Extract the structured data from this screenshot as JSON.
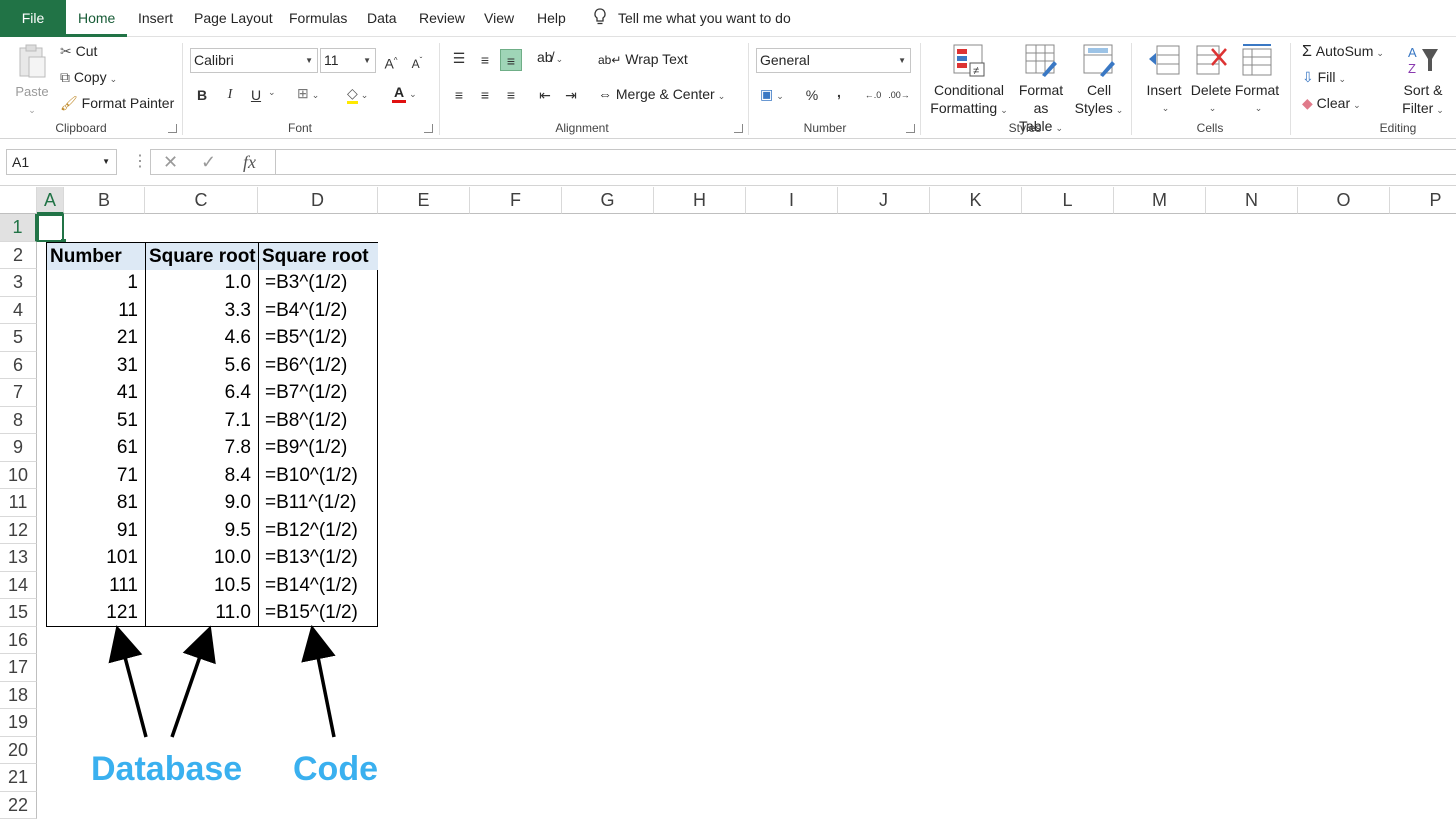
{
  "tabs": [
    "File",
    "Home",
    "Insert",
    "Page Layout",
    "Formulas",
    "Data",
    "Review",
    "View",
    "Help"
  ],
  "tell_me": "Tell me what you want to do",
  "clipboard": {
    "paste": "Paste",
    "cut": "Cut",
    "copy": "Copy",
    "format_painter": "Format Painter",
    "label": "Clipboard"
  },
  "font": {
    "name": "Calibri",
    "size": "11",
    "label": "Font",
    "bold": "B",
    "italic": "I",
    "underline": "U",
    "grow": "A",
    "shrink": "A"
  },
  "alignment": {
    "wrap": "Wrap Text",
    "merge": "Merge & Center",
    "label": "Alignment"
  },
  "number": {
    "format": "General",
    "label": "Number",
    "percent": "%",
    "comma": ","
  },
  "styles": {
    "cond1": "Conditional",
    "cond2": "Formatting",
    "fat1": "Format as",
    "fat2": "Table",
    "cell1": "Cell",
    "cell2": "Styles",
    "label": "Styles"
  },
  "cells": {
    "insert": "Insert",
    "delete": "Delete",
    "format": "Format",
    "label": "Cells"
  },
  "editing": {
    "autosum": "AutoSum",
    "fill": "Fill",
    "clear": "Clear",
    "sort1": "Sort &",
    "sort2": "Filter",
    "label": "Editing"
  },
  "namebox": "A1",
  "columns": [
    "A",
    "B",
    "C",
    "D",
    "E",
    "F",
    "G",
    "H",
    "I",
    "J",
    "K",
    "L",
    "M",
    "N",
    "O",
    "P"
  ],
  "rows": [
    "1",
    "2",
    "3",
    "4",
    "5",
    "6",
    "7",
    "8",
    "9",
    "10",
    "11",
    "12",
    "13",
    "14",
    "15",
    "16",
    "17",
    "18",
    "19",
    "20",
    "21",
    "22"
  ],
  "table": {
    "headers": [
      "Number",
      "Square root",
      "Square root"
    ],
    "rows": [
      [
        "1",
        "1.0",
        "=B3^(1/2)"
      ],
      [
        "11",
        "3.3",
        "=B4^(1/2)"
      ],
      [
        "21",
        "4.6",
        "=B5^(1/2)"
      ],
      [
        "31",
        "5.6",
        "=B6^(1/2)"
      ],
      [
        "41",
        "6.4",
        "=B7^(1/2)"
      ],
      [
        "51",
        "7.1",
        "=B8^(1/2)"
      ],
      [
        "61",
        "7.8",
        "=B9^(1/2)"
      ],
      [
        "71",
        "8.4",
        "=B10^(1/2)"
      ],
      [
        "81",
        "9.0",
        "=B11^(1/2)"
      ],
      [
        "91",
        "9.5",
        "=B12^(1/2)"
      ],
      [
        "101",
        "10.0",
        "=B13^(1/2)"
      ],
      [
        "111",
        "10.5",
        "=B14^(1/2)"
      ],
      [
        "121",
        "11.0",
        "=B15^(1/2)"
      ]
    ]
  },
  "annotations": {
    "left": "Database",
    "right": "Code",
    "color": "#3ab0ef"
  },
  "colors": {
    "excel_green": "#217346",
    "header_fill": "#dde9f5"
  }
}
